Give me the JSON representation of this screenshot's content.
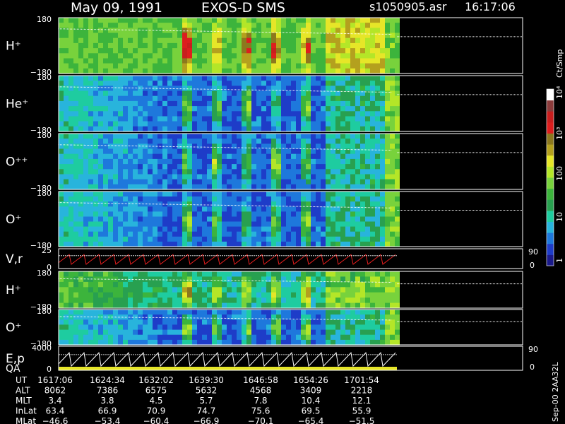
{
  "header": {
    "date": "May 09, 1991",
    "instrument": "EXOS-D SMS",
    "file": "s1050905.asr",
    "time": "16:17:06"
  },
  "side_caption": "Sep-00 2AA32L",
  "chart_data": {
    "type": "heatmap",
    "panels": [
      {
        "label": "H⁺",
        "ymax": "180",
        "ymin": "−180",
        "kind": "spectrogram",
        "intensity": "high"
      },
      {
        "label": "He⁺",
        "ymax": "180",
        "ymin": "−180",
        "kind": "spectrogram",
        "intensity": "low"
      },
      {
        "label": "O⁺⁺",
        "ymax": "180",
        "ymin": "−180",
        "kind": "spectrogram",
        "intensity": "low"
      },
      {
        "label": "O⁺",
        "ymax": "180",
        "ymin": "−180",
        "kind": "spectrogram",
        "intensity": "low"
      },
      {
        "label": "V,r",
        "ymax": "25",
        "ymin": "0",
        "right_top": "90",
        "right_bottom": "0",
        "kind": "line"
      },
      {
        "label": "H⁺",
        "ymax": "180",
        "ymin": "−180",
        "kind": "spectrogram",
        "intensity": "mid"
      },
      {
        "label": "O⁺",
        "ymax": "180",
        "ymin": "−180",
        "kind": "spectrogram",
        "intensity": "low"
      },
      {
        "label": "E,p",
        "label2": "QA",
        "ymax": "4000",
        "ymin": "0",
        "right_top": "90",
        "right_bottom": "0",
        "kind": "line"
      }
    ],
    "colorbar": {
      "unit": "Ct/Smp",
      "ticks": [
        {
          "label": "1",
          "value": 1
        },
        {
          "label": "10",
          "value": 10
        },
        {
          "label": "100",
          "value": 100
        },
        {
          "label": "10³",
          "value": 1000
        },
        {
          "label": "10⁴",
          "value": 10000
        }
      ],
      "colors": [
        "#1a1a8c",
        "#1e3cc8",
        "#1e78dc",
        "#28b4dc",
        "#1ecca0",
        "#28a050",
        "#3cb43c",
        "#78d23c",
        "#b4e628",
        "#e6e628",
        "#b4a01e",
        "#8c781e",
        "#dc1e1e",
        "#c81e1e",
        "#8c3c3c",
        "#ffffff"
      ]
    },
    "ephemeris": {
      "rows": [
        {
          "name": "UT",
          "values": [
            "1617:06",
            "1624:34",
            "1632:02",
            "1639:30",
            "1646:58",
            "1654:26",
            "1701:54"
          ]
        },
        {
          "name": "ALT",
          "values": [
            "8062",
            "7386",
            "6575",
            "5632",
            "4568",
            "3409",
            "2218"
          ]
        },
        {
          "name": "MLT",
          "values": [
            "3.4",
            "3.8",
            "4.5",
            "5.7",
            "7.8",
            "10.4",
            "12.1"
          ]
        },
        {
          "name": "InLat",
          "values": [
            "63.4",
            "66.9",
            "70.9",
            "74.7",
            "75.6",
            "69.5",
            "55.9"
          ]
        },
        {
          "name": "MLat",
          "values": [
            "−46.6",
            "−53.4",
            "−60.4",
            "−66.9",
            "−70.1",
            "−65.4",
            "−51.5"
          ]
        }
      ]
    }
  }
}
